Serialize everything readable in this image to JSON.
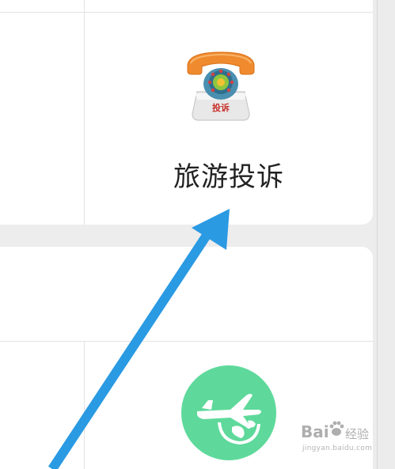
{
  "grid": {
    "complaint_tile": {
      "label": "旅游投诉",
      "icon": "phone-icon",
      "badge_text": "投诉"
    },
    "travel_tile": {
      "icon": "airplane-globe-icon",
      "icon_color": "#5ed99b"
    }
  },
  "overlay": {
    "arrow_color": "#2a9ae3",
    "arrow_icon": "arrow-up-right-icon"
  },
  "watermark": {
    "main": "Bai",
    "suffix": "经验",
    "sub": "jingyan.baidu.com"
  },
  "colors": {
    "page_bg": "#ededed",
    "card_bg": "#ffffff",
    "grid_line": "#e3e3e3",
    "label_text": "#222222"
  }
}
